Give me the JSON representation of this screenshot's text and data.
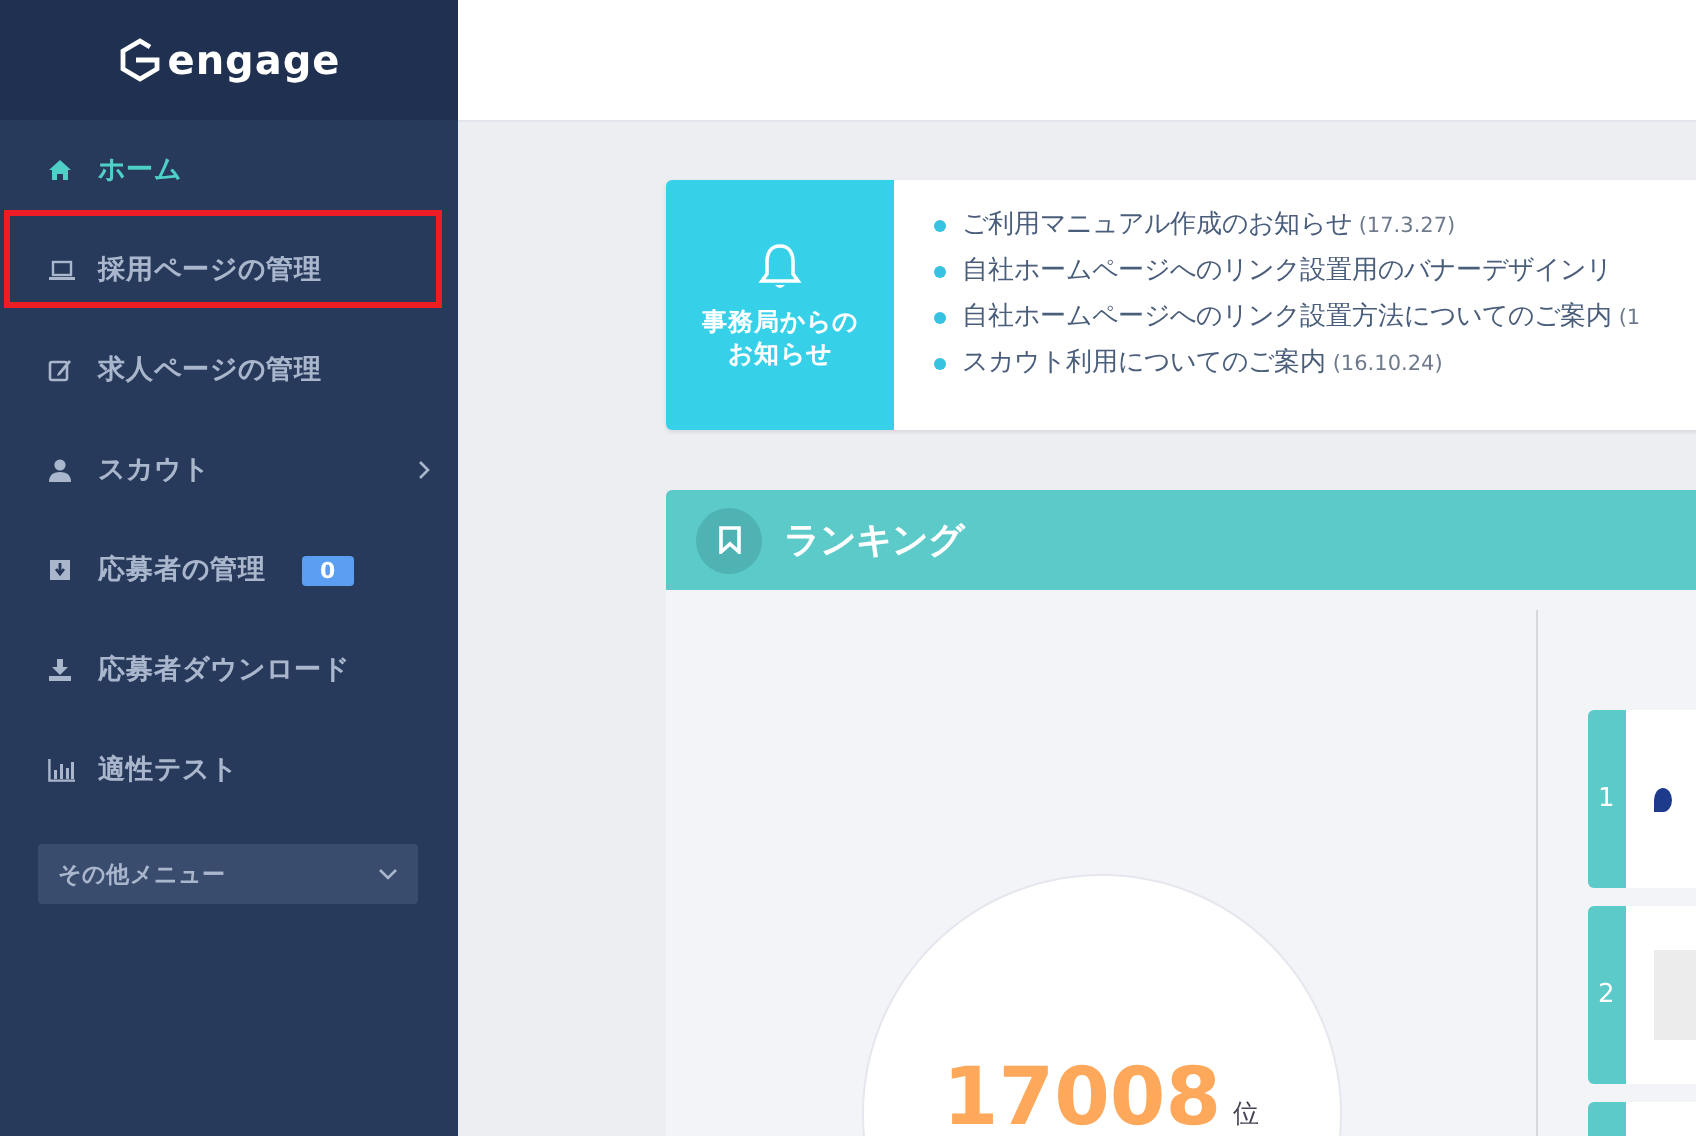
{
  "sidebar": {
    "logo": "engage",
    "items": [
      {
        "label": "ホーム",
        "selected": true,
        "highlighted": false
      },
      {
        "label": "採用ページの管理",
        "selected": false,
        "highlighted": true
      },
      {
        "label": "求人ページの管理",
        "selected": false,
        "highlighted": false
      },
      {
        "label": "スカウト",
        "selected": false,
        "highlighted": false,
        "has_submenu": true
      },
      {
        "label": "応募者の管理",
        "selected": false,
        "highlighted": false,
        "badge": "0"
      },
      {
        "label": "応募者ダウンロード",
        "selected": false,
        "highlighted": false
      },
      {
        "label": "適性テスト",
        "selected": false,
        "highlighted": false
      }
    ],
    "more_menu": {
      "label": "その他メニュー",
      "expanded": false
    }
  },
  "notices": {
    "title": [
      "事務局からの",
      "お知らせ"
    ],
    "items": [
      {
        "text": "ご利用マニュアル作成のお知らせ",
        "date": "(17.3.27)"
      },
      {
        "text": "自社ホームページへのリンク設置用のバナーデザインリ"
      },
      {
        "text": "自社ホームページへのリンク設置方法についてのご案内",
        "date": "(1"
      },
      {
        "text": "スカウト利用についてのご案内",
        "date": "(16.10.24)"
      }
    ]
  },
  "ranking": {
    "title": "ランキング",
    "rank": "17008",
    "rank_unit": "位",
    "entries": [
      "1",
      "2"
    ]
  }
}
